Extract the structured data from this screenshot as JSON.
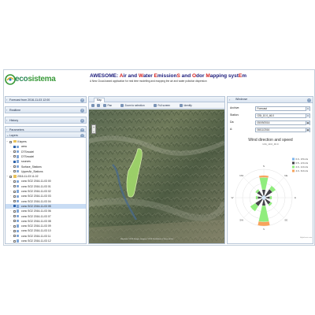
{
  "header": {
    "logo_text_prefix": "eco",
    "logo_text_suffix": "sistema",
    "title_parts": [
      {
        "text": "AWESOME: ",
        "hl": false
      },
      {
        "text": "A",
        "hl": true
      },
      {
        "text": "ir and ",
        "hl": false
      },
      {
        "text": "W",
        "hl": true
      },
      {
        "text": "ater ",
        "hl": false
      },
      {
        "text": "E",
        "hl": true
      },
      {
        "text": "mission",
        "hl": false
      },
      {
        "text": "S",
        "hl": true
      },
      {
        "text": " and ",
        "hl": false
      },
      {
        "text": "O",
        "hl": true
      },
      {
        "text": "dor ",
        "hl": false
      },
      {
        "text": "M",
        "hl": true
      },
      {
        "text": "apping syst",
        "hl": false
      },
      {
        "text": "E",
        "hl": true
      },
      {
        "text": "m",
        "hl": false
      }
    ],
    "subtitle": "A New Cloud-based application for real time modelling and mapping the air and water pollution dispersion"
  },
  "left_panel": {
    "sections": [
      {
        "label": "Forecast from 2016-11-03 12:00"
      },
      {
        "label": "Realtime"
      },
      {
        "label": "History"
      },
      {
        "label": "Parameters"
      },
      {
        "label": "Layers"
      }
    ],
    "tree": [
      {
        "label": "Il layers",
        "level": 0,
        "type": "folder",
        "expanded": true,
        "checked": false,
        "selected": false
      },
      {
        "label": "area",
        "level": 1,
        "type": "layer",
        "checked": true,
        "selected": false
      },
      {
        "label": "DTSmodel",
        "level": 1,
        "type": "layer",
        "checked": false,
        "selected": false
      },
      {
        "label": "DTSmodel",
        "level": 1,
        "type": "layer",
        "checked": false,
        "selected": false
      },
      {
        "label": "sources",
        "level": 1,
        "type": "layer",
        "checked": true,
        "selected": false
      },
      {
        "label": "Surface_Stations",
        "level": 1,
        "type": "layer",
        "checked": false,
        "selected": false
      },
      {
        "label": "UpperAir_Stations",
        "level": 1,
        "type": "layer",
        "checked": false,
        "selected": false
      },
      {
        "label": "2016-11-03 11-02",
        "level": 0,
        "type": "folder",
        "expanded": true,
        "checked": false,
        "selected": false
      },
      {
        "label": "conc SO2 2016-11-03 00",
        "level": 1,
        "type": "layer",
        "checked": false,
        "selected": false
      },
      {
        "label": "conc SO2 2016-11-03 01",
        "level": 1,
        "type": "layer",
        "checked": false,
        "selected": false
      },
      {
        "label": "conc SO2 2016-11-03 02",
        "level": 1,
        "type": "layer",
        "checked": false,
        "selected": false
      },
      {
        "label": "conc SO2 2016-11-03 03",
        "level": 1,
        "type": "layer",
        "checked": false,
        "selected": false
      },
      {
        "label": "conc SO2 2016-11-03 04",
        "level": 1,
        "type": "layer",
        "checked": false,
        "selected": false
      },
      {
        "label": "conc SO2 2016-11-03 05",
        "level": 1,
        "type": "layer",
        "checked": true,
        "selected": true
      },
      {
        "label": "conc SO2 2016-11-03 06",
        "level": 1,
        "type": "layer",
        "checked": false,
        "selected": false
      },
      {
        "label": "conc SO2 2016-11-03 07",
        "level": 1,
        "type": "layer",
        "checked": false,
        "selected": false
      },
      {
        "label": "conc SO2 2016-11-03 08",
        "level": 1,
        "type": "layer",
        "checked": false,
        "selected": false
      },
      {
        "label": "conc SO2 2016-11-03 09",
        "level": 1,
        "type": "layer",
        "checked": false,
        "selected": false
      },
      {
        "label": "conc SO2 2016-11-03 10",
        "level": 1,
        "type": "layer",
        "checked": false,
        "selected": false
      },
      {
        "label": "conc SO2 2016-11-03 11",
        "level": 1,
        "type": "layer",
        "checked": false,
        "selected": false
      },
      {
        "label": "conc SO2 2016-11-03 12",
        "level": 1,
        "type": "layer",
        "checked": false,
        "selected": false
      }
    ]
  },
  "map_panel": {
    "tab_label": "Map",
    "toolbar": {
      "pan_label": "Pan",
      "zoom_selection_label": "Zoom to selection",
      "fullscreen_label": "Full screen",
      "identify_label": "Identify"
    },
    "zoom_in": "+",
    "zoom_out": "−",
    "attribution": "Map data ©2016 Google, Imagery ©2016 TerraMetrics | Terms of Use"
  },
  "right_panel": {
    "header_label": "Windrose",
    "fields": [
      {
        "label": "Archive:",
        "value": "Forecast",
        "dropdown": true
      },
      {
        "label": "Station:",
        "value": "GSt_10.0_46.0",
        "dropdown": true
      },
      {
        "label": "Da:",
        "value": "05/09/2016",
        "dropdown": false
      },
      {
        "label": "A:",
        "value": "06/11/2016",
        "dropdown": false
      }
    ],
    "credit": "Highcharts.com"
  },
  "chart_data": {
    "type": "windrose",
    "title": "Wind direction and speed",
    "subtitle": "GSt_10.0_46.0",
    "directions": [
      "N",
      "NE",
      "E",
      "SE",
      "S",
      "SW",
      "W",
      "NW"
    ],
    "series": [
      {
        "name": "0.0 - 0.5 m/s",
        "color": "#7cb5ec",
        "values": [
          1,
          1,
          1,
          1,
          1,
          1,
          1,
          1
        ]
      },
      {
        "name": "0.5 - 2.0 m/s",
        "color": "#434348",
        "values": [
          3,
          4,
          2,
          3,
          3,
          4,
          2,
          3
        ]
      },
      {
        "name": "2.0 - 4.0 m/s",
        "color": "#90ed7d",
        "values": [
          6,
          2,
          1,
          1,
          8,
          3,
          1,
          1
        ]
      },
      {
        "name": "4.0 - 6.0 m/s",
        "color": "#f7a35c",
        "values": [
          1,
          0,
          0,
          0,
          2,
          0,
          0,
          0
        ]
      }
    ],
    "legend_position": "top-right"
  }
}
